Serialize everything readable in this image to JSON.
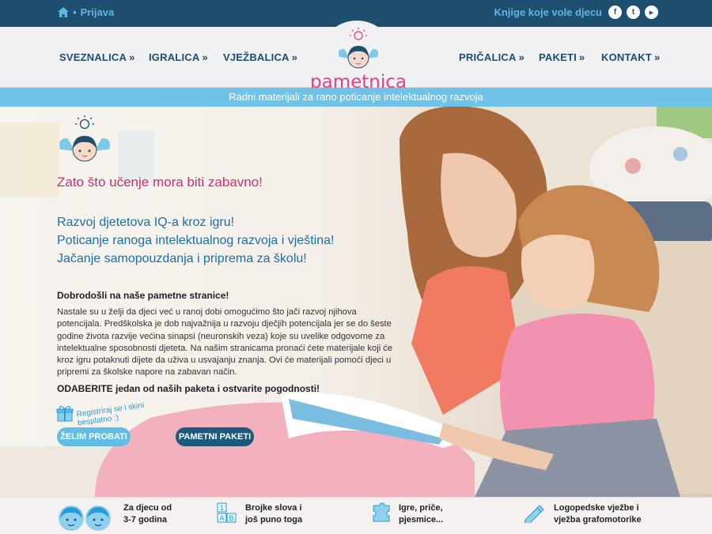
{
  "topbar": {
    "login": "Prijava",
    "tagline": "Knjige koje vole djecu",
    "social": [
      {
        "icon": "facebook-icon",
        "glyph": "f"
      },
      {
        "icon": "twitter-icon",
        "glyph": "t"
      },
      {
        "icon": "youtube-icon",
        "glyph": "▶"
      }
    ]
  },
  "nav": {
    "left": [
      {
        "label": "SVEZNALICA",
        "arrow": "»"
      },
      {
        "label": "IGRALICA",
        "arrow": "»"
      },
      {
        "label": "VJEŽBALICA",
        "arrow": "»"
      }
    ],
    "right": [
      {
        "label": "PRIČALICA",
        "arrow": "»"
      },
      {
        "label": "PAKETI",
        "arrow": "»"
      },
      {
        "label": "KONTAKT",
        "arrow": "»"
      }
    ],
    "logo": "pametnica"
  },
  "subtitle": "Radni materijali za rano poticanje intelektualnog razvoja",
  "hero": {
    "headline": "Zato što učenje mora biti zabavno!",
    "benefits": [
      "Razvoj djetetova IQ-a kroz igru!",
      "Poticanje ranoga intelektualnog razvoja i vještina!",
      "Jačanje samopouzdanja i priprema za školu!"
    ],
    "welcome": "Dobrodošli na naše pametne stranice!",
    "intro": "Nastale su u želji da djeci već u ranoj dobi omogućimo što jači razvoj njihova potencijala. Predškolska je dob najvažnija u razvoju dječjih potencijala jer se do šeste godine života razvije većina sinapsi (neuronskih veza) koje su uvelike odgovorne za intelektualne sposobnosti djeteta. Na našim stranicama pronaći ćete materijale koji će kroz igru potaknuti dijete da uživa u usvajanju znanja. Ovi će materijali pomoći djeci u pripremi za školske napore na zabavan način.",
    "cta": "ODABERITE jedan od naših paketa i ostvarite pogodnosti!",
    "register_note": "Registriraj se i skini besplatno :)",
    "btn_try": "ŽELIM PROBATI",
    "btn_packs": "PAMETNI PAKETI"
  },
  "features": [
    {
      "icon": "kids-faces-icon",
      "line1": "Za djecu od",
      "line2": "3-7 godina"
    },
    {
      "icon": "letter-blocks-icon",
      "line1": "Brojke slova i",
      "line2": "još puno toga"
    },
    {
      "icon": "puzzle-icon",
      "line1": "Igre, priče,",
      "line2": "pjesmice..."
    },
    {
      "icon": "pencil-icon",
      "line1": "Logopedske vježbe i",
      "line2": "vježba grafomotorike"
    }
  ],
  "colors": {
    "topbar": "#1f4f6e",
    "accent_blue": "#6fc3e8",
    "brand_pink": "#e0418a",
    "nav_text": "#1e4e6d",
    "headline_pink": "#cf2f73",
    "benefit_blue": "#1b6fa5"
  }
}
